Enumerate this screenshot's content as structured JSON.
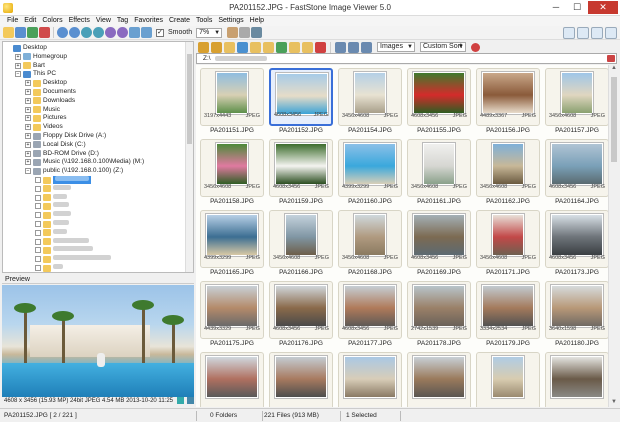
{
  "window": {
    "title": "PA201152.JPG  -  FastStone Image Viewer 5.0",
    "minimize": "─",
    "maximize": "☐",
    "close": "✕"
  },
  "menu": [
    "File",
    "Edit",
    "Colors",
    "Effects",
    "View",
    "Tag",
    "Favorites",
    "Create",
    "Tools",
    "Settings",
    "Help"
  ],
  "toolbar": {
    "smooth_label": "Smooth",
    "smooth_checked": "✓",
    "zoom_value": "7%",
    "filter_value": "Images",
    "sort_value": "Custom Sort"
  },
  "path": "Z:\\",
  "tree": [
    {
      "label": "Desktop",
      "icon": "pc",
      "level": 0,
      "exp": ""
    },
    {
      "label": "Homegroup",
      "icon": "net",
      "level": 1,
      "exp": "+"
    },
    {
      "label": "Bart",
      "icon": "folder",
      "level": 1,
      "exp": "+"
    },
    {
      "label": "This PC",
      "icon": "pc",
      "level": 1,
      "exp": "−"
    },
    {
      "label": "Desktop",
      "icon": "folder",
      "level": 2,
      "exp": "+"
    },
    {
      "label": "Documents",
      "icon": "folder",
      "level": 2,
      "exp": "+"
    },
    {
      "label": "Downloads",
      "icon": "folder",
      "level": 2,
      "exp": "+"
    },
    {
      "label": "Music",
      "icon": "folder",
      "level": 2,
      "exp": "+"
    },
    {
      "label": "Pictures",
      "icon": "folder",
      "level": 2,
      "exp": "+"
    },
    {
      "label": "Videos",
      "icon": "folder",
      "level": 2,
      "exp": "+"
    },
    {
      "label": "Floppy Disk Drive (A:)",
      "icon": "drive",
      "level": 2,
      "exp": "+"
    },
    {
      "label": "Local Disk (C:)",
      "icon": "drive",
      "level": 2,
      "exp": "+"
    },
    {
      "label": "BD-ROM Drive (D:)",
      "icon": "drive",
      "level": 2,
      "exp": "+"
    },
    {
      "label": "Music (\\\\192.168.0.100\\Media) (M:)",
      "icon": "drive",
      "level": 2,
      "exp": "+"
    },
    {
      "label": "public (\\\\192.168.0.100) (Z:)",
      "icon": "drive",
      "level": 2,
      "exp": "−"
    }
  ],
  "preview": {
    "label": "Preview",
    "status": "4608 x 3456 (15.93 MP)  24bit  JPEG  4.54 MB  2013-10-20 11:25"
  },
  "thumbnails": [
    {
      "name": "PA201151.JPG",
      "dims": "3197x4443",
      "type": "JPEG",
      "portrait": true,
      "colors": [
        "#8fbde0",
        "#d8d0b4",
        "#5d8f4a"
      ]
    },
    {
      "name": "PA201152.JPG",
      "dims": "4608x3456",
      "type": "JPEG",
      "portrait": false,
      "selected": true,
      "colors": [
        "#a7cbe8",
        "#e6dcc8",
        "#3aa2d6"
      ]
    },
    {
      "name": "PA201154.JPG",
      "dims": "3456x4608",
      "type": "JPEG",
      "portrait": true,
      "colors": [
        "#b5d0e6",
        "#e8e2d2",
        "#a89f8a"
      ]
    },
    {
      "name": "PA201155.JPG",
      "dims": "4608x3456",
      "type": "JPEG",
      "portrait": false,
      "colors": [
        "#3f7a2d",
        "#d42b2b",
        "#2e5e22"
      ]
    },
    {
      "name": "PA201156.JPG",
      "dims": "4489x3367",
      "type": "JPEG",
      "portrait": false,
      "colors": [
        "#c9a88a",
        "#8a5a3a",
        "#e8dccb"
      ]
    },
    {
      "name": "PA201157.JPG",
      "dims": "3456x4608",
      "type": "JPEG",
      "portrait": true,
      "colors": [
        "#9fc6e8",
        "#e0d6c0",
        "#8aa070"
      ]
    },
    {
      "name": "PA201158.JPG",
      "dims": "3456x4608",
      "type": "JPEG",
      "portrait": true,
      "colors": [
        "#4e8a3a",
        "#e07aa0",
        "#2f5e24"
      ]
    },
    {
      "name": "PA201159.JPG",
      "dims": "4608x3456",
      "type": "JPEG",
      "portrait": false,
      "colors": [
        "#3d6d2d",
        "#f4f4f0",
        "#2b4e20"
      ]
    },
    {
      "name": "PA201160.JPG",
      "dims": "4399x3299",
      "type": "JPEG",
      "portrait": false,
      "colors": [
        "#8cc0e8",
        "#3aa8dc",
        "#d8cfb8"
      ]
    },
    {
      "name": "PA201161.JPG",
      "dims": "3456x4608",
      "type": "JPEG",
      "portrait": true,
      "colors": [
        "#f0f0ee",
        "#d6d6d2",
        "#8aa08a"
      ]
    },
    {
      "name": "PA201162.JPG",
      "dims": "3456x4608",
      "type": "JPEG",
      "portrait": true,
      "colors": [
        "#7fb0d8",
        "#c8b898",
        "#6a5a40"
      ]
    },
    {
      "name": "PA201164.JPG",
      "dims": "4608x3456",
      "type": "JPEG",
      "portrait": false,
      "colors": [
        "#b0c4d4",
        "#7aa0b8",
        "#5a6a70"
      ]
    },
    {
      "name": "PA201165.JPG",
      "dims": "4399x3299",
      "type": "JPEG",
      "portrait": false,
      "colors": [
        "#b8d0e6",
        "#3c6e92",
        "#d8c8a4"
      ]
    },
    {
      "name": "PA201166.JPG",
      "dims": "3456x4608",
      "type": "JPEG",
      "portrait": true,
      "colors": [
        "#c4d2dc",
        "#8096a4",
        "#6e5e4a"
      ]
    },
    {
      "name": "PA201168.JPG",
      "dims": "3456x4608",
      "type": "JPEG",
      "portrait": true,
      "colors": [
        "#cfd8dc",
        "#b09a80",
        "#8a7a60"
      ]
    },
    {
      "name": "PA201169.JPG",
      "dims": "4608x3456",
      "type": "JPEG",
      "portrait": false,
      "colors": [
        "#a4b0b6",
        "#7c6a52",
        "#5c6a72"
      ]
    },
    {
      "name": "PA201171.JPG",
      "dims": "3456x4608",
      "type": "JPEG",
      "portrait": true,
      "colors": [
        "#e8e0d8",
        "#c24848",
        "#6e6050"
      ]
    },
    {
      "name": "PA201173.JPG",
      "dims": "4608x3456",
      "type": "JPEG",
      "portrait": false,
      "colors": [
        "#d8e0e6",
        "#6e747a",
        "#3a3e42"
      ]
    },
    {
      "name": "PA201175.JPG",
      "dims": "4439x3329",
      "type": "JPEG",
      "portrait": false,
      "colors": [
        "#c8d0d6",
        "#b48a6a",
        "#6a6a6a"
      ]
    },
    {
      "name": "PA201176.JPG",
      "dims": "4608x3456",
      "type": "JPEG",
      "portrait": false,
      "colors": [
        "#d0d6da",
        "#8a6a4a",
        "#4a4a4a"
      ]
    },
    {
      "name": "PA201177.JPG",
      "dims": "4608x3456",
      "type": "JPEG",
      "portrait": false,
      "colors": [
        "#c6ced4",
        "#b07a5a",
        "#5e5a56"
      ]
    },
    {
      "name": "PA201178.JPG",
      "dims": "2742x1539",
      "type": "JPEG",
      "portrait": false,
      "colors": [
        "#b8c4ca",
        "#9a8068",
        "#6a625a"
      ]
    },
    {
      "name": "PA201179.JPG",
      "dims": "3334x2534",
      "type": "JPEG",
      "portrait": false,
      "colors": [
        "#c2cad0",
        "#a47a5c",
        "#525252"
      ]
    },
    {
      "name": "PA201180.JPG",
      "dims": "3640x1598",
      "type": "JPEG",
      "portrait": false,
      "colors": [
        "#d6dadc",
        "#b89878",
        "#706a64"
      ]
    },
    {
      "name": "",
      "dims": "",
      "type": "",
      "portrait": false,
      "colors": [
        "#d0d8de",
        "#b07060",
        "#5a5a5a"
      ]
    },
    {
      "name": "",
      "dims": "",
      "type": "",
      "portrait": false,
      "colors": [
        "#c4ccd2",
        "#a87a60",
        "#4e4e4e"
      ]
    },
    {
      "name": "",
      "dims": "",
      "type": "",
      "portrait": false,
      "colors": [
        "#aac8e4",
        "#d8cdb8",
        "#8a7a64"
      ]
    },
    {
      "name": "",
      "dims": "",
      "type": "",
      "portrait": false,
      "colors": [
        "#c8d0d6",
        "#9a7a5c",
        "#5a5652"
      ]
    },
    {
      "name": "",
      "dims": "",
      "type": "",
      "portrait": true,
      "colors": [
        "#b0cce4",
        "#d8ccb0",
        "#9a8a70"
      ]
    },
    {
      "name": "",
      "dims": "",
      "type": "",
      "portrait": false,
      "colors": [
        "#e4e4e0",
        "#6a5a48",
        "#8a8a86"
      ]
    }
  ],
  "status": {
    "file": "PA201152.JPG [ 2 / 221 ]",
    "folders": "0 Folders",
    "files": "221 Files (913 MB)",
    "selected": "1 Selected"
  }
}
